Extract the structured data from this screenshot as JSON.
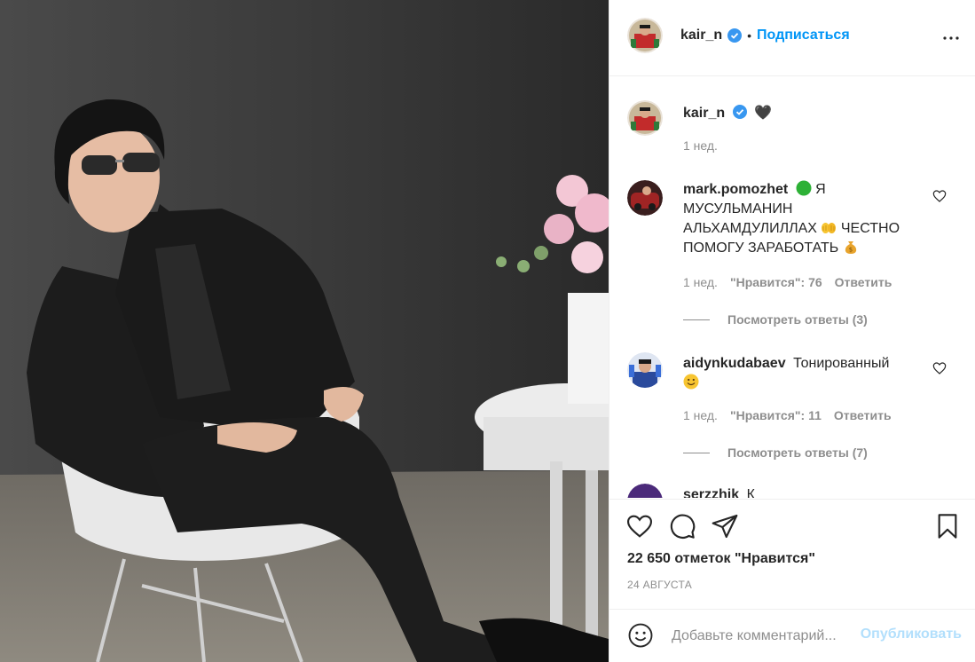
{
  "post": {
    "author": "kair_n",
    "follow_label": "Подписаться",
    "dot": "•",
    "caption": {
      "username": "kair_n",
      "text": "🖤",
      "time": "1 нед."
    },
    "comments": [
      {
        "username": "mark.pomozhet",
        "text_parts": [
          "Я МУСУЛЬМАНИН АЛЬХАМДУЛИЛЛАХ",
          "ЧЕСТНО ПОМОГУ ЗАРАБОТАТЬ"
        ],
        "time": "1 нед.",
        "likes": "\"Нравится\": 76",
        "reply": "Ответить",
        "view_replies": "Посмотреть ответы (3)"
      },
      {
        "username": "aidynkudabaev",
        "text": "Тонированный",
        "time": "1 нед.",
        "likes": "\"Нравится\": 11",
        "reply": "Ответить",
        "view_replies": "Посмотреть ответы (7)"
      },
      {
        "username": "serzzhik",
        "text": "К"
      }
    ],
    "likes_count": "22 650 отметок \"Нравится\"",
    "date": "24 АВГУСТА",
    "comment_input": {
      "placeholder": "Добавьте комментарий..."
    },
    "publish_label": "Опубликовать"
  },
  "icons": {
    "more": "more-horizontal-icon",
    "heart": "heart-icon",
    "comment": "comment-icon",
    "share": "share-icon",
    "save": "bookmark-icon",
    "emoji": "smiley-icon",
    "verified": "verified-badge-icon"
  },
  "colors": {
    "link_blue": "#0095f6",
    "publish_disabled": "#b2dffc",
    "verified_blue": "#3897f0",
    "muted_text": "#8e8e8e",
    "divider": "#efefef"
  }
}
